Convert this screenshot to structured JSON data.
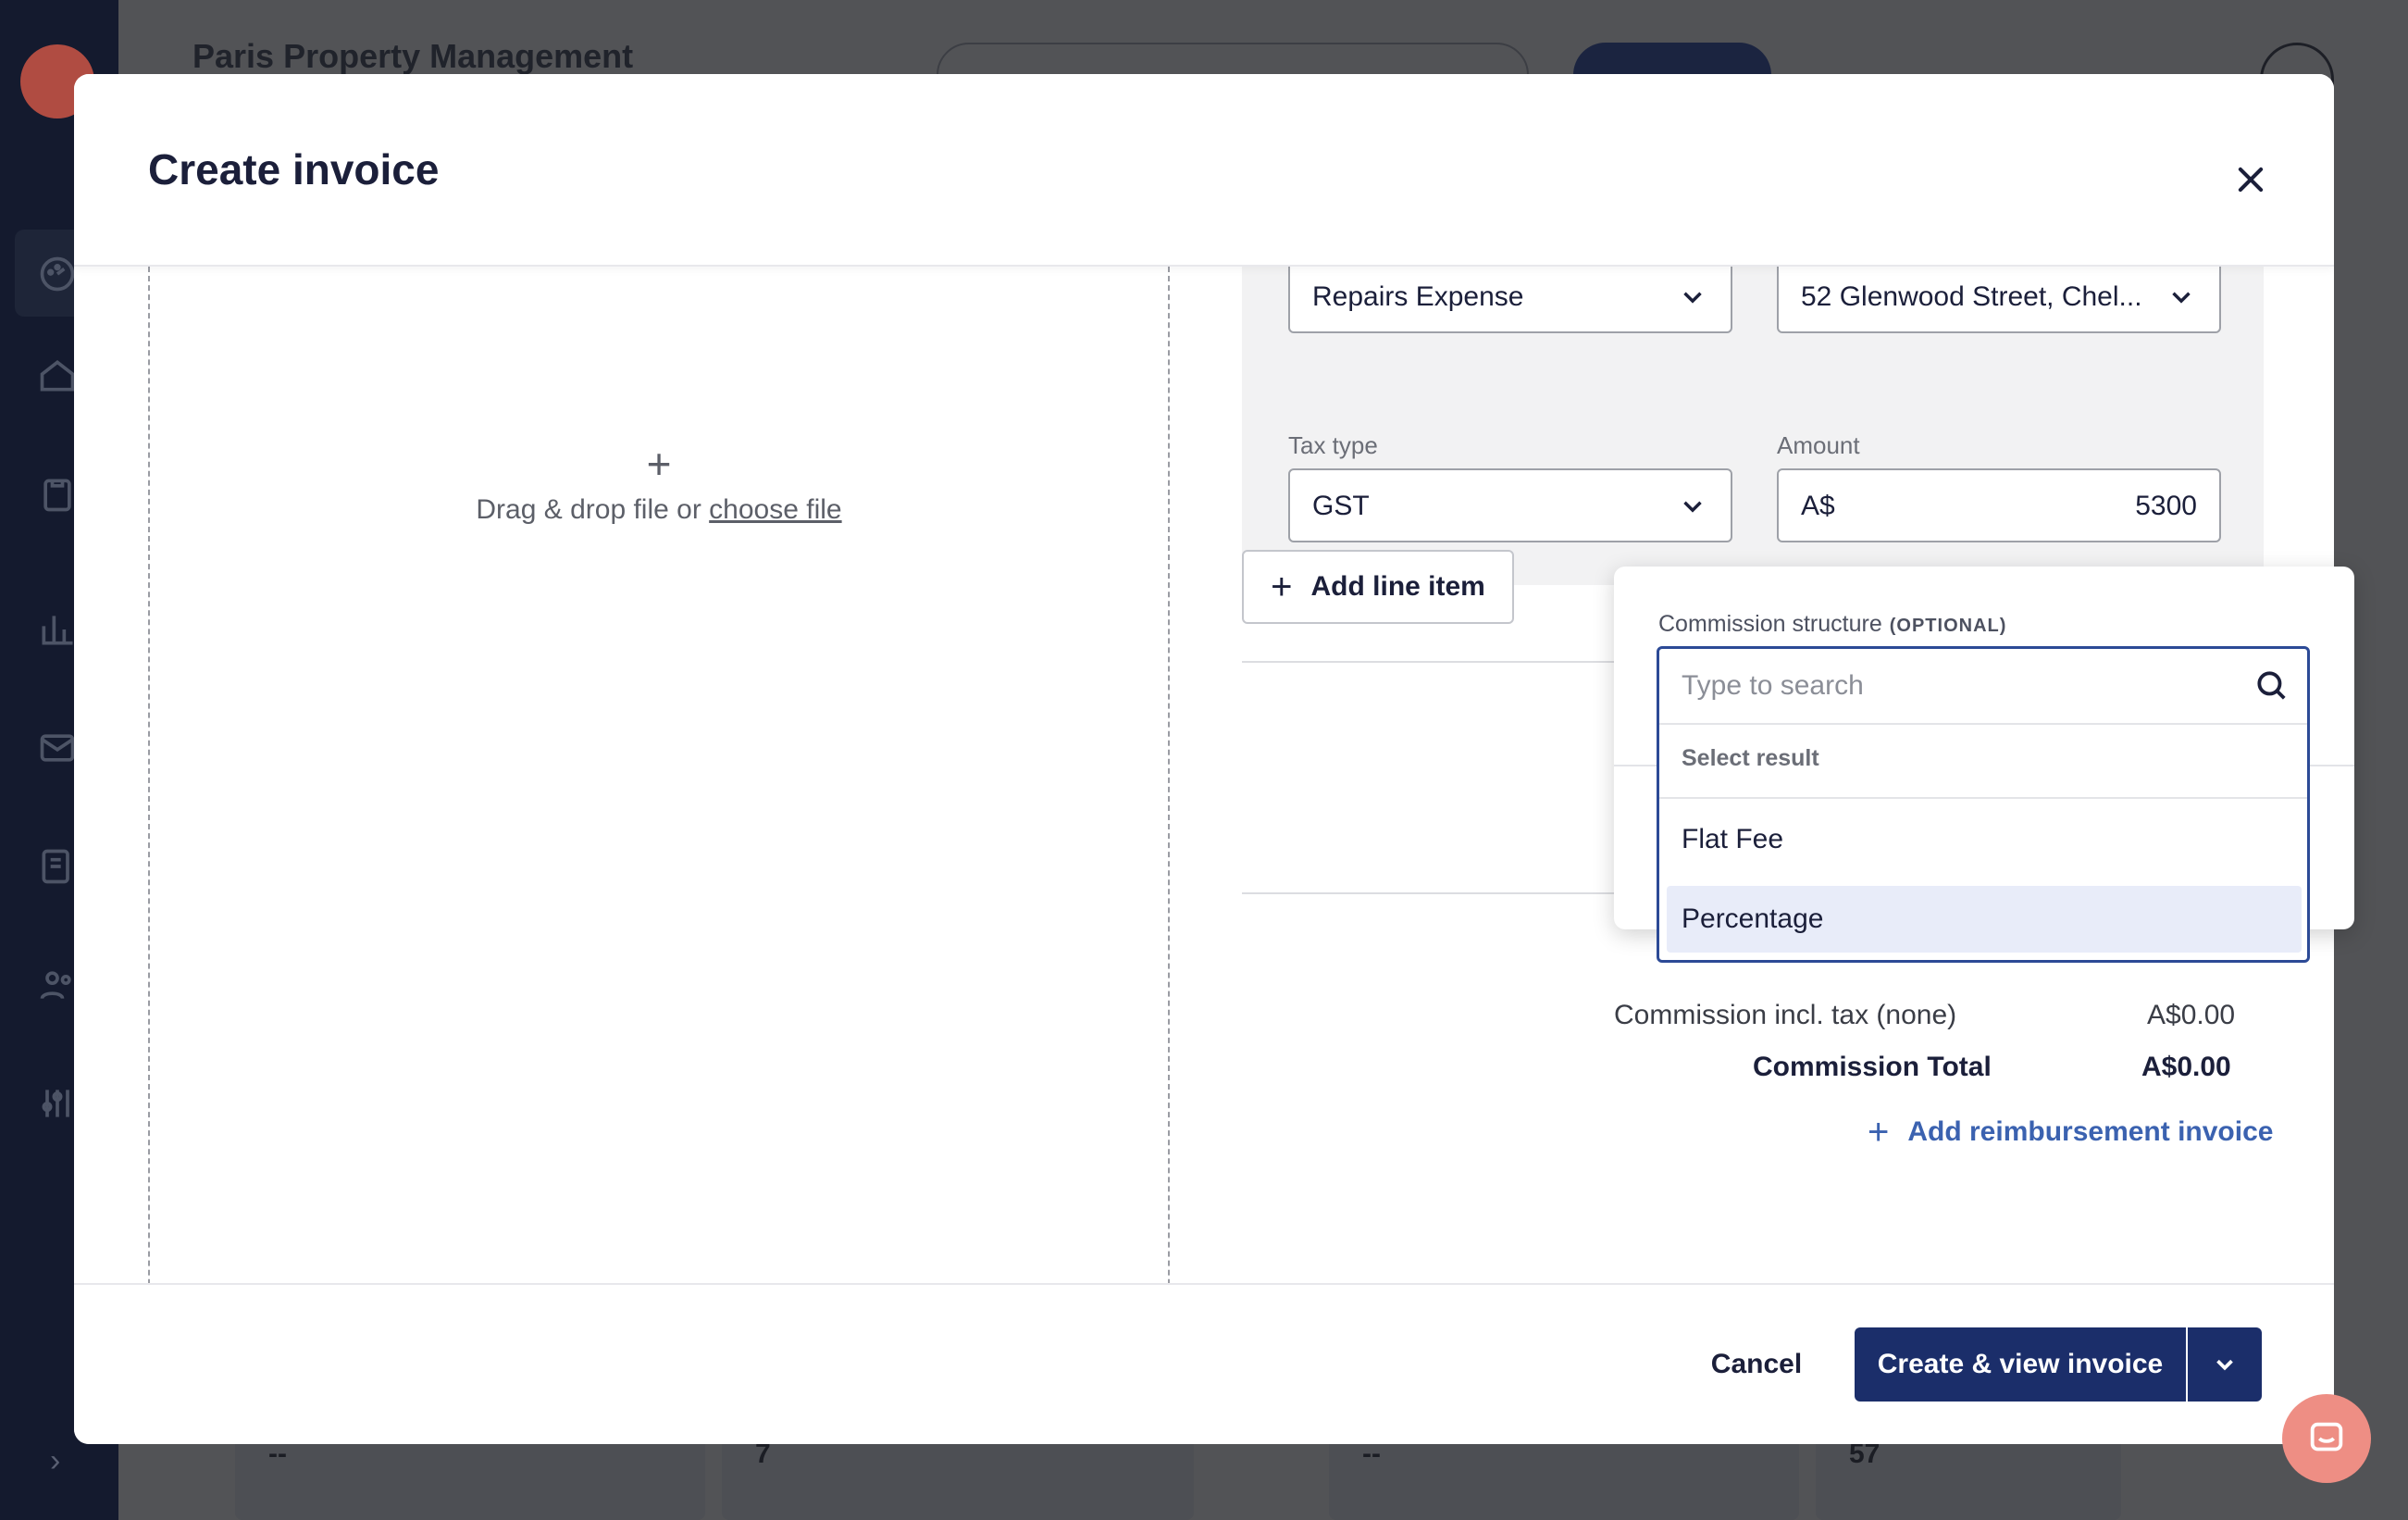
{
  "app": {
    "title": "Paris Property Management",
    "bg_cells": [
      "--",
      "7",
      "--",
      "57"
    ],
    "sidebar_icons": [
      "dashboard-icon",
      "home-icon",
      "clipboard-icon",
      "reports-icon",
      "mail-icon",
      "documents-icon",
      "contacts-icon",
      "settings-sliders-icon"
    ]
  },
  "modal": {
    "title": "Create invoice",
    "dropzone": {
      "plus": "+",
      "text": "Drag & drop file or ",
      "link": "choose file"
    },
    "line_item": {
      "account_value": "Repairs Expense",
      "property_value": "52 Glenwood Street, Chel...",
      "tax_type_label": "Tax type",
      "tax_type_value": "GST",
      "amount_label": "Amount",
      "amount_prefix": "A$",
      "amount_value": "5300"
    },
    "add_line_item": "Add line item",
    "summary": {
      "commission_tax_label": "Commission incl. tax (none)",
      "commission_tax_value": "A$0.00",
      "commission_total_label": "Commission Total",
      "commission_total_value": "A$0.00"
    },
    "add_reimbursement": "Add reimbursement invoice",
    "footer": {
      "cancel": "Cancel",
      "primary": "Create & view invoice"
    }
  },
  "commission_popover": {
    "label": "Commission structure",
    "optional": "(OPTIONAL)",
    "search_placeholder": "Type to search",
    "hint": "Select result",
    "options": [
      "Flat Fee",
      "Percentage"
    ],
    "hovered_option": "Percentage"
  },
  "colors": {
    "primary": "#1b2e6a",
    "link": "#3b62b0",
    "focus_border": "#2c4a96",
    "chat": "#ee8e84"
  }
}
